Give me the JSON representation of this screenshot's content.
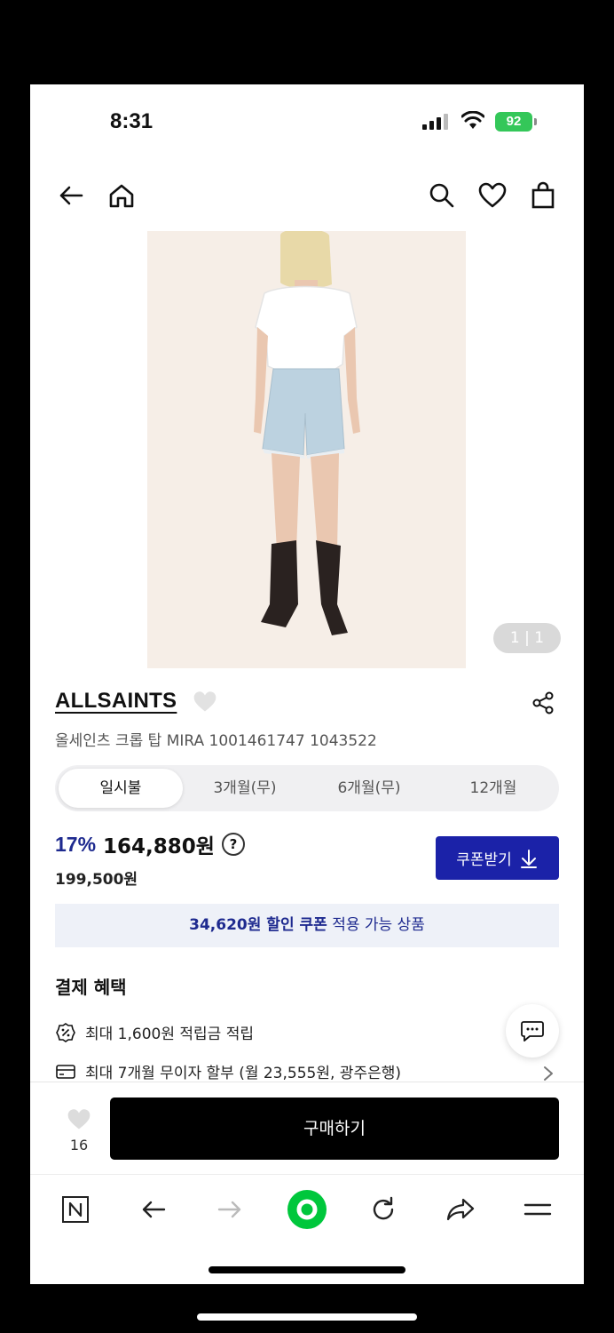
{
  "status_bar": {
    "time": "8:31",
    "battery": "92"
  },
  "product": {
    "image_counter": "1 | 1",
    "brand": "ALLSAINTS",
    "title": "올세인츠 크롭 탑 MIRA 1001461747 1043522"
  },
  "installment_tabs": [
    "일시불",
    "3개월(무)",
    "6개월(무)",
    "12개월"
  ],
  "price": {
    "discount": "17%",
    "sale_price": "164,880원",
    "help": "?",
    "original_price": "199,500원",
    "coupon_button": "쿠폰받기"
  },
  "promo": {
    "highlight": "34,620원 할인 쿠폰",
    "rest": "적용 가능 상품"
  },
  "benefits": {
    "title": "결제 혜택",
    "items": [
      "최대 1,600원 적립금 적립",
      "최대 7개월 무이자 할부 (월 23,555원, 광주은행)"
    ]
  },
  "bottom": {
    "like_count": "16",
    "buy_label": "구매하기"
  },
  "colors": {
    "accent": "#1b22a8",
    "buy": "#000000",
    "browser_green": "#00c73c"
  }
}
